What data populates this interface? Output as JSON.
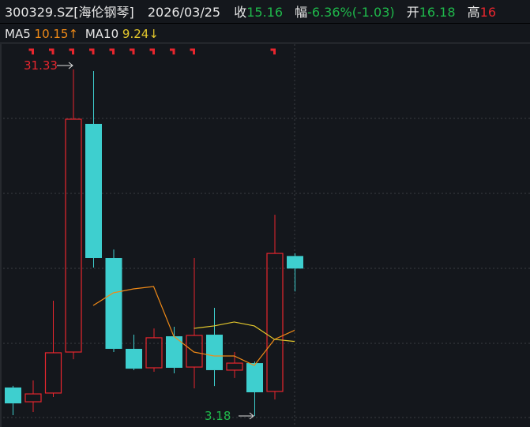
{
  "header": {
    "symbol": "300329.SZ[海伦钢琴]",
    "date": "2026/03/25",
    "close_label": "收",
    "close": "15.16",
    "change_label": "幅",
    "change": "-6.36%(-1.03)",
    "open_label": "开",
    "open": "16.18",
    "high_label": "高",
    "high": "16"
  },
  "ma_bar": {
    "ma5_label": "MA5",
    "ma5_value": "10.15",
    "ma5_arrow": "↑",
    "ma10_label": "MA10",
    "ma10_value": "9.24",
    "ma10_arrow": "↓"
  },
  "colors": {
    "up": "#e8262e",
    "down": "#3ecfcf",
    "ma5": "#f08a17",
    "ma10": "#e3c72c",
    "background": "#14171c"
  },
  "chart_data": {
    "type": "candlestick",
    "ylim": [
      2.6,
      33.0
    ],
    "grid": true,
    "max_label": "31.33",
    "min_label": "3.18",
    "candles": [
      {
        "o": 5.5,
        "h": 5.63,
        "l": 3.25,
        "c": 4.21
      },
      {
        "o": 4.34,
        "h": 6.07,
        "l": 3.51,
        "c": 4.98
      },
      {
        "o": 5.05,
        "h": 12.55,
        "l": 4.73,
        "c": 8.32
      },
      {
        "o": 8.38,
        "h": 31.33,
        "l": 7.8,
        "c": 27.29
      },
      {
        "o": 26.91,
        "h": 31.2,
        "l": 15.24,
        "c": 16.01
      },
      {
        "o": 16.01,
        "h": 16.71,
        "l": 8.38,
        "c": 8.64
      },
      {
        "o": 8.64,
        "h": 9.79,
        "l": 6.91,
        "c": 7.03
      },
      {
        "o": 7.1,
        "h": 10.3,
        "l": 6.78,
        "c": 9.54
      },
      {
        "o": 9.66,
        "h": 10.43,
        "l": 6.65,
        "c": 7.1
      },
      {
        "o": 7.16,
        "h": 16.01,
        "l": 5.43,
        "c": 9.73
      },
      {
        "o": 9.79,
        "h": 11.97,
        "l": 5.62,
        "c": 6.91
      },
      {
        "o": 6.91,
        "h": 8.38,
        "l": 6.27,
        "c": 7.48
      },
      {
        "o": 7.48,
        "h": 7.61,
        "l": 3.18,
        "c": 5.11
      },
      {
        "o": 5.18,
        "h": 19.53,
        "l": 4.53,
        "c": 16.39
      },
      {
        "o": 16.18,
        "h": 16.4,
        "l": 13.3,
        "c": 15.16
      }
    ],
    "ma5": [
      null,
      null,
      null,
      null,
      12.16,
      13.19,
      13.51,
      13.7,
      9.66,
      8.38,
      8.06,
      8.06,
      7.29,
      9.41,
      10.15
    ],
    "ma10": [
      null,
      null,
      null,
      null,
      null,
      null,
      null,
      null,
      null,
      10.3,
      10.5,
      10.82,
      10.5,
      9.41,
      9.24
    ],
    "limit_up_markers": [
      1,
      2,
      3,
      4,
      5,
      6,
      7,
      8,
      9,
      13
    ]
  }
}
